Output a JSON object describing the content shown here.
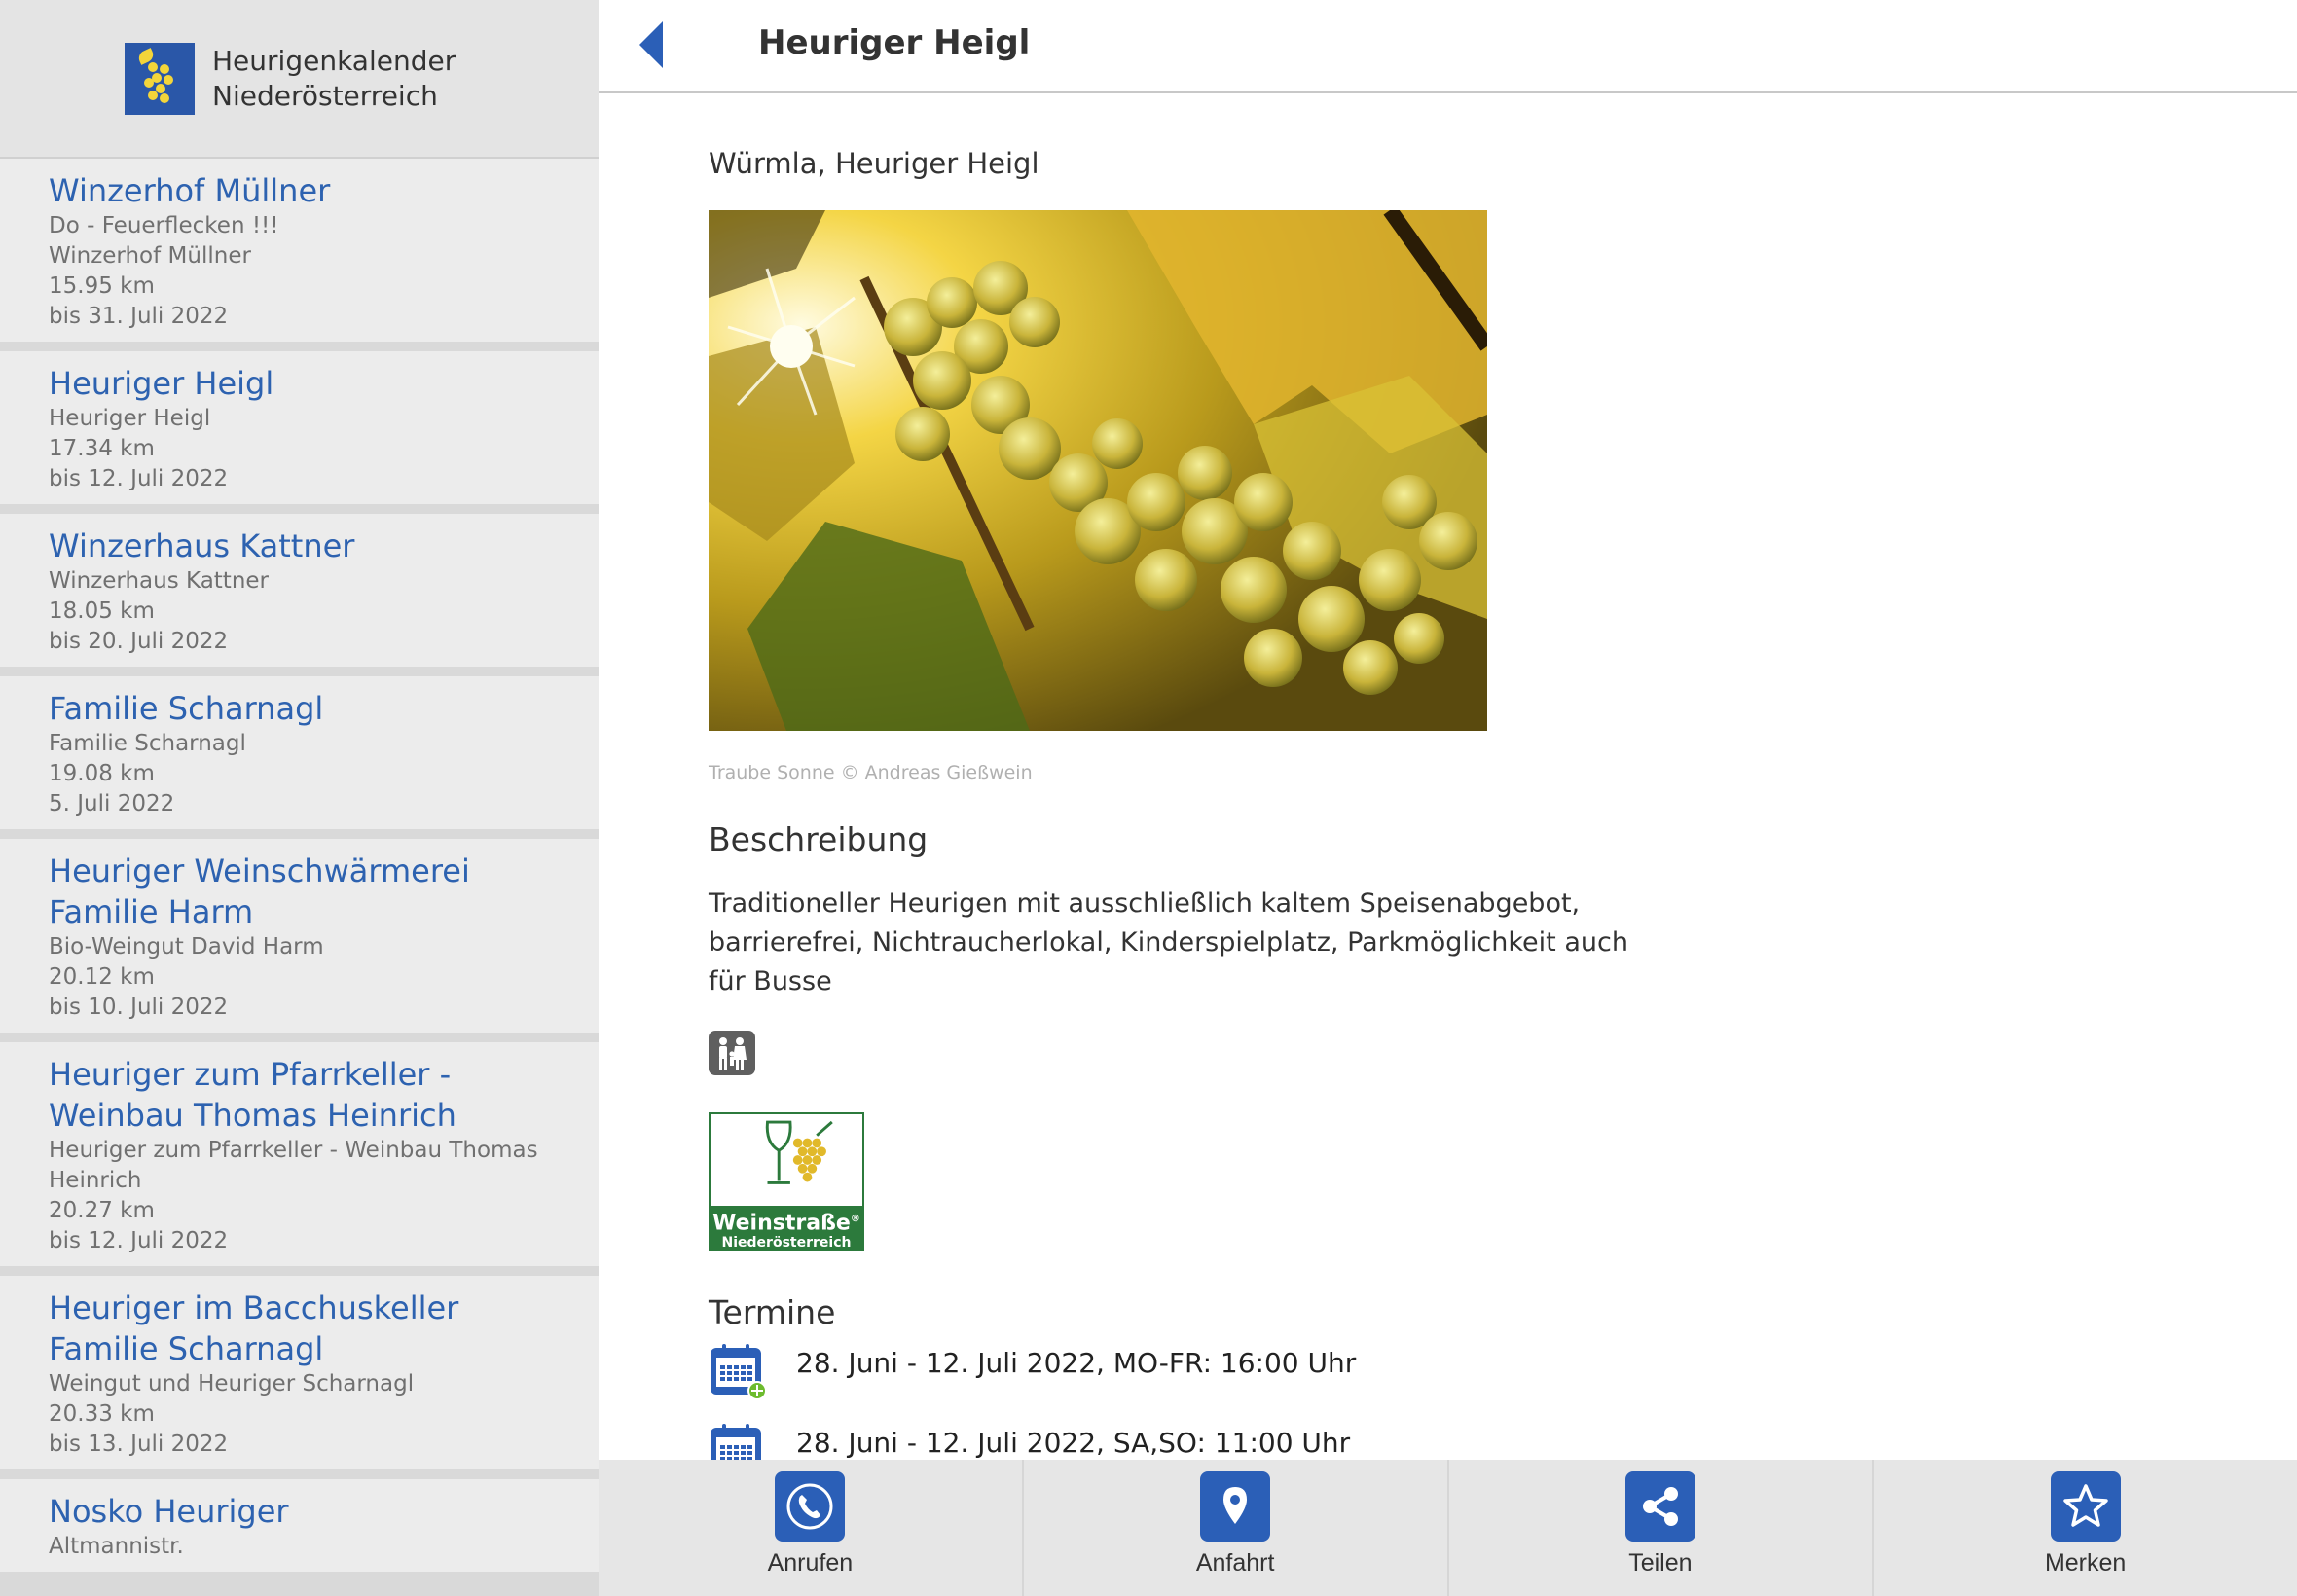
{
  "app": {
    "title_line1": "Heurigenkalender",
    "title_line2": "Niederösterreich"
  },
  "list": [
    {
      "title": "Winzerhof Müllner",
      "lines": [
        "Do - Feuerflecken !!!",
        "Winzerhof Müllner",
        "15.95 km",
        "bis 31. Juli 2022"
      ]
    },
    {
      "title": "Heuriger Heigl",
      "lines": [
        "Heuriger Heigl",
        "17.34 km",
        "bis 12. Juli 2022"
      ]
    },
    {
      "title": "Winzerhaus Kattner",
      "lines": [
        "Winzerhaus Kattner",
        "18.05 km",
        "bis 20. Juli 2022"
      ]
    },
    {
      "title": "Familie Scharnagl",
      "lines": [
        "Familie Scharnagl",
        "19.08 km",
        "5. Juli 2022"
      ]
    },
    {
      "title": "Heuriger Weinschwärmerei Familie Harm",
      "lines": [
        "Bio-Weingut David Harm",
        "20.12 km",
        "bis 10. Juli 2022"
      ]
    },
    {
      "title": "Heuriger zum Pfarrkeller - Weinbau Thomas Heinrich",
      "lines": [
        "Heuriger zum Pfarrkeller - Weinbau Thomas Heinrich",
        "20.27 km",
        "bis 12. Juli 2022"
      ]
    },
    {
      "title": "Heuriger im Bacchuskeller Familie Scharnagl",
      "lines": [
        "Weingut und Heuriger Scharnagl",
        "20.33 km",
        "bis 13. Juli 2022"
      ]
    },
    {
      "title": "Nosko Heuriger",
      "lines": [
        "Altmannistr."
      ]
    }
  ],
  "detail": {
    "title": "Heuriger Heigl",
    "location": "Würmla, Heuriger Heigl",
    "photo_caption": "Traube Sonne © Andreas Gießwein",
    "description_heading": "Beschreibung",
    "description": "Traditioneller Heurigen mit ausschließlich kaltem Speisenabgebot, barrierefrei, Nichtraucherlokal, Kinderspielplatz, Parkmöglichkeit auch für Busse",
    "badge_icon": "family-icon",
    "weinstrasse_name": "Weinstraße",
    "weinstrasse_mark": "®",
    "weinstrasse_region": "Niederösterreich",
    "termine_heading": "Termine",
    "termine": [
      "28. Juni - 12. Juli 2022, MO-FR: 16:00 Uhr",
      "28. Juni - 12. Juli 2022, SA,SO: 11:00 Uhr"
    ]
  },
  "toolbar": {
    "call": "Anrufen",
    "directions": "Anfahrt",
    "share": "Teilen",
    "bookmark": "Merken"
  },
  "colors": {
    "accent": "#2b5fb7",
    "link": "#2d62b0",
    "weinstrasse_green": "#2c7a3c",
    "grape_yellow": "#f3d53a"
  }
}
